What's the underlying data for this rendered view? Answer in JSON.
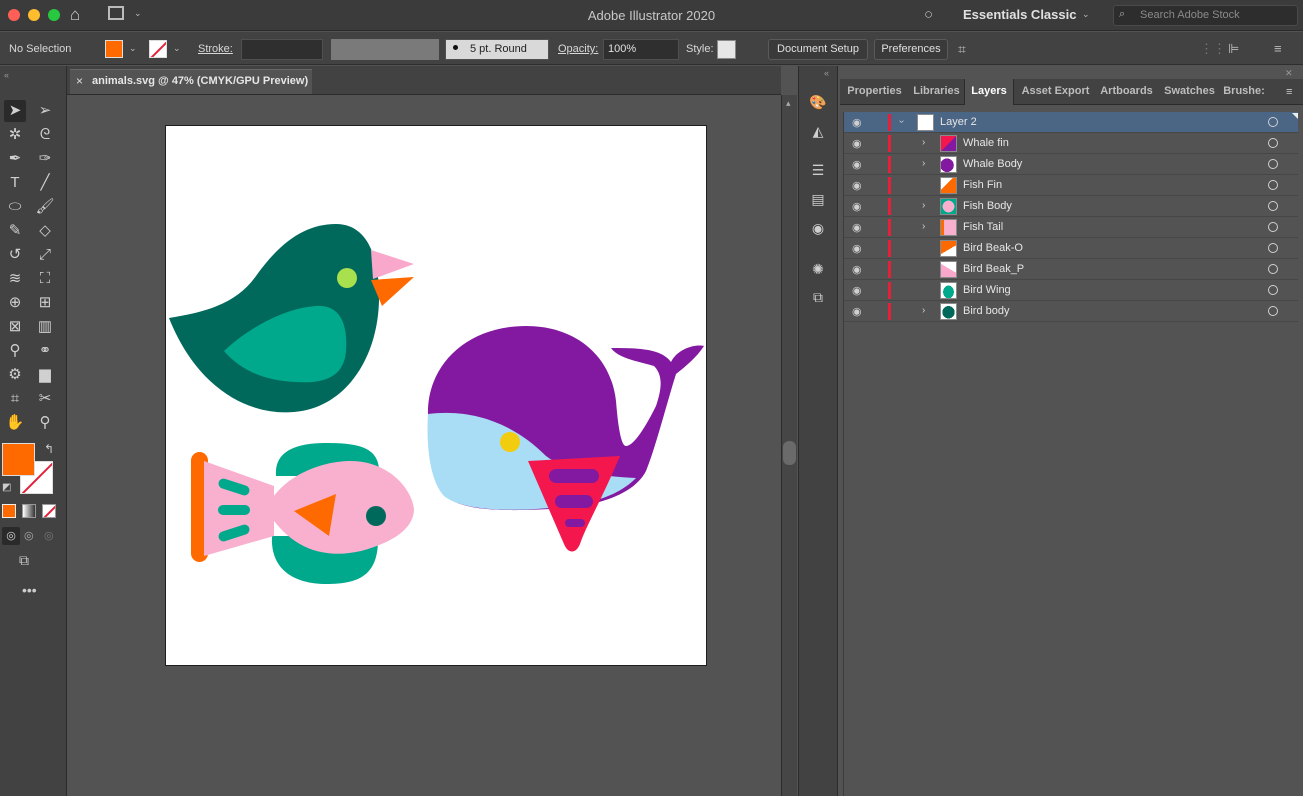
{
  "app": {
    "title": "Adobe Illustrator 2020",
    "workspace": "Essentials Classic",
    "search_placeholder": "Search Adobe Stock"
  },
  "control": {
    "selection": "No Selection",
    "stroke_label": "Stroke:",
    "brush": "5 pt. Round",
    "opacity_label": "Opacity:",
    "opacity_value": "100%",
    "style_label": "Style:",
    "doc_setup": "Document Setup",
    "preferences": "Preferences",
    "fill_color": "#ff6a00"
  },
  "document": {
    "tab": "animals.svg @ 47% (CMYK/GPU Preview)",
    "close": "×"
  },
  "panel": {
    "tabs": [
      "Properties",
      "Libraries",
      "Layers",
      "Asset Export",
      "Artboards",
      "Swatches",
      "Brushe:"
    ],
    "active_tab": "Layers",
    "layers": [
      {
        "name": "Layer 2",
        "expanded": true,
        "selected": true
      },
      {
        "name": "Whale fin",
        "expandable": true
      },
      {
        "name": "Whale Body",
        "expandable": true
      },
      {
        "name": "Fish Fin",
        "expandable": false
      },
      {
        "name": "Fish Body",
        "expandable": true
      },
      {
        "name": "Fish Tail",
        "expandable": true
      },
      {
        "name": "Bird Beak-O",
        "expandable": false
      },
      {
        "name": "Bird Beak_P",
        "expandable": false
      },
      {
        "name": "Bird Wing",
        "expandable": false
      },
      {
        "name": "Bird body",
        "expandable": true
      }
    ]
  },
  "colors": {
    "bird_body": "#00695c",
    "bird_wing": "#00a98c",
    "beak_orange": "#ff6a00",
    "beak_pink": "#f9a8cc",
    "whale_body": "#8319a0",
    "whale_belly": "#a9ddf5",
    "whale_fin": "#f3174d",
    "fish_pink": "#f9afce",
    "fish_teal": "#00a98c",
    "layer_accent": "#e5213a"
  }
}
